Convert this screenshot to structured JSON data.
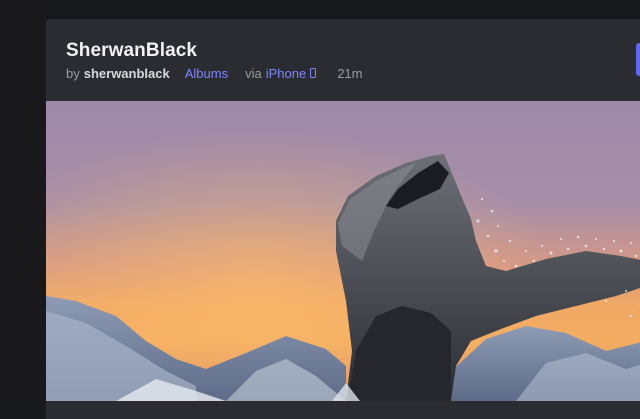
{
  "post": {
    "title": "SherwanBlack",
    "by_label": "by",
    "author": "sherwanblack",
    "albums_label": "Albums",
    "via_label": "via",
    "device": "iPhone",
    "time": "21m"
  },
  "icons": {
    "device": "phone-icon"
  },
  "colors": {
    "accent": "#6366f1",
    "link": "#7f86ff"
  }
}
